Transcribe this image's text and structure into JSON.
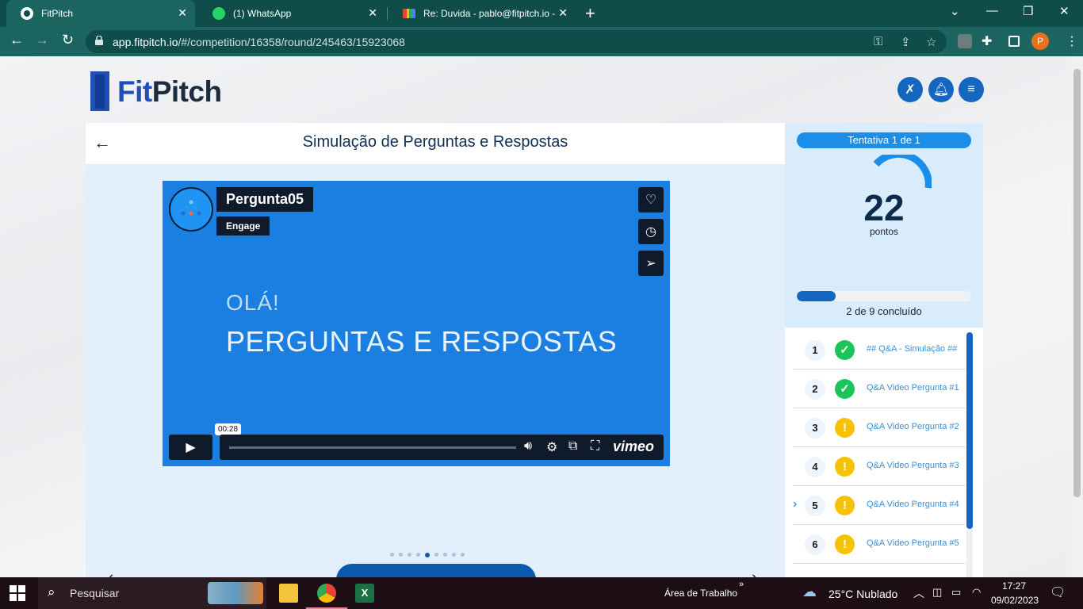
{
  "browser": {
    "tabs": [
      {
        "title": "FitPitch",
        "icon": "fitpitch-favicon",
        "active": true
      },
      {
        "title": "(1) WhatsApp",
        "icon": "whatsapp-icon",
        "active": false
      },
      {
        "title": "Re: Duvida - pablo@fitpitch.io - F",
        "icon": "gmail-icon",
        "active": false
      }
    ],
    "url_host": "app.fitpitch.io",
    "url_path": "/#/competition/16358/round/245463/15923068",
    "profile_initial": "P"
  },
  "app": {
    "logo_fit": "Fit",
    "logo_pitch": "Pitch",
    "header_buttons": [
      "tools-icon",
      "bell-icon",
      "menu-icon"
    ]
  },
  "main": {
    "title": "Simulação de Perguntas e Respostas",
    "video": {
      "title": "Pergunta05",
      "subtitle": "Engage",
      "line1": "OLÁ!",
      "line2": "PERGUNTAS E RESPOSTAS",
      "time": "00:28",
      "brand": "vimeo"
    },
    "carousel": {
      "count": 9,
      "active_index": 4
    }
  },
  "side": {
    "attempt": "Tentativa 1 de 1",
    "score": "22",
    "score_label": "pontos",
    "progress_label": "2 de 9 concluído",
    "progress_fraction": 0.222,
    "items": [
      {
        "num": "1",
        "status": "done",
        "label": "## Q&A - Simulação ##"
      },
      {
        "num": "2",
        "status": "done",
        "label": "Q&A Video Pergunta #1"
      },
      {
        "num": "3",
        "status": "warn",
        "label": "Q&A Video Pergunta #2"
      },
      {
        "num": "4",
        "status": "warn",
        "label": "Q&A Video Pergunta #3"
      },
      {
        "num": "5",
        "status": "warn",
        "label": "Q&A Video Pergunta #4",
        "current": true
      },
      {
        "num": "6",
        "status": "warn",
        "label": "Q&A Video Pergunta #5"
      }
    ]
  },
  "taskbar": {
    "search": "Pesquisar",
    "desktop": "Área de Trabalho",
    "weather": "25°C  Nublado",
    "time": "17:27",
    "date": "09/02/2023"
  },
  "colors": {
    "brand_blue": "#1566c0",
    "video_blue": "#1a7fe0",
    "done_green": "#1bc559",
    "warn_yellow": "#f7c200",
    "browser_teal": "#0e4d4a"
  }
}
